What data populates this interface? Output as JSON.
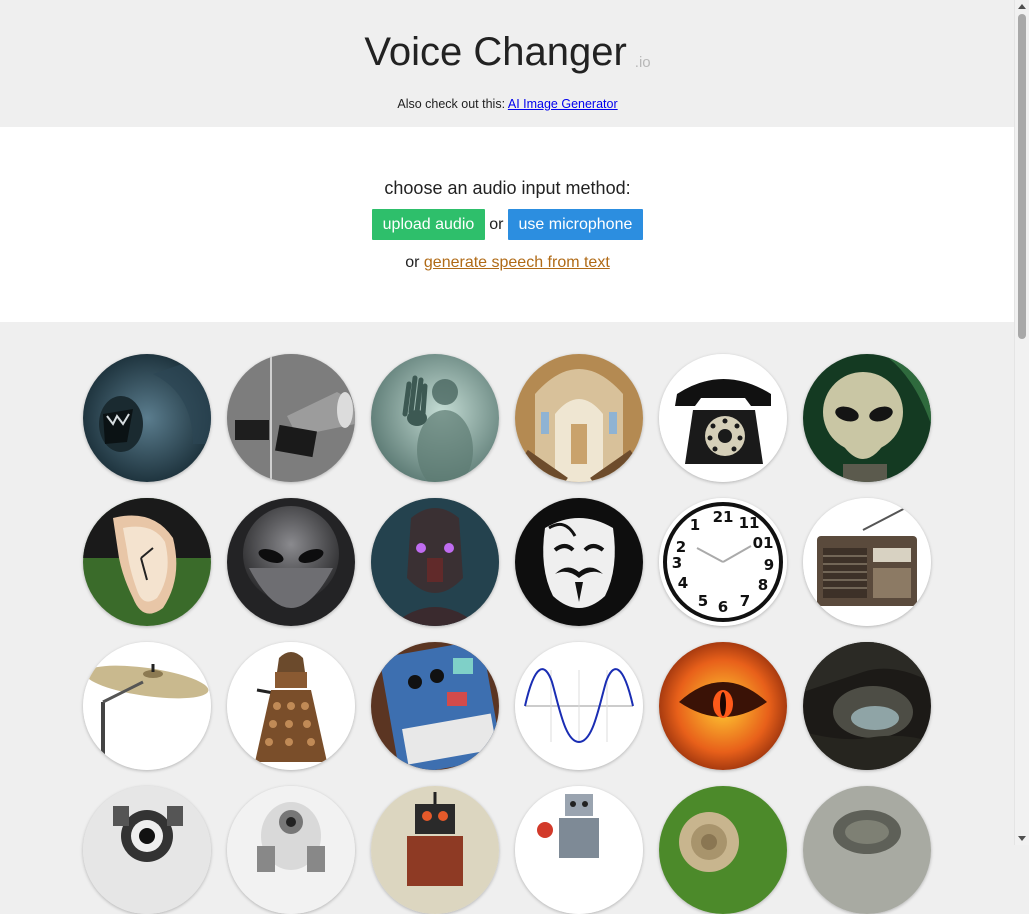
{
  "header": {
    "title": "Voice Changer",
    "title_suffix": ".io",
    "also_prefix": "Also check out this:",
    "also_link": "AI Image Generator"
  },
  "input": {
    "prompt": "choose an audio input method:",
    "upload_label": "upload audio",
    "or_label": "or",
    "mic_label": "use microphone",
    "gen_prefix": "or",
    "gen_link": "generate speech from text"
  },
  "colors": {
    "upload_button": "#2ebf6b",
    "mic_button": "#2c8ee0",
    "gen_link": "#b06a16",
    "page_bg": "#efefef"
  },
  "voices": [
    {
      "icon": "monster-roar-icon"
    },
    {
      "icon": "megaphone-icon"
    },
    {
      "icon": "ghost-icon"
    },
    {
      "icon": "cathedral-icon"
    },
    {
      "icon": "telephone-icon"
    },
    {
      "icon": "alien-icon"
    },
    {
      "icon": "melting-clock-icon"
    },
    {
      "icon": "grey-alien-icon"
    },
    {
      "icon": "robot-mask-icon"
    },
    {
      "icon": "anonymous-mask-icon"
    },
    {
      "icon": "reversed-clock-icon"
    },
    {
      "icon": "radio-icon"
    },
    {
      "icon": "cymbal-icon"
    },
    {
      "icon": "dalek-icon"
    },
    {
      "icon": "guitar-pedal-icon"
    },
    {
      "icon": "sine-wave-icon"
    },
    {
      "icon": "fire-eye-icon"
    },
    {
      "icon": "cave-icon"
    },
    {
      "icon": "robot-eye-icon"
    },
    {
      "icon": "white-robot-icon"
    },
    {
      "icon": "toy-robot-icon"
    },
    {
      "icon": "tin-robot-icon"
    },
    {
      "icon": "snail-icon"
    },
    {
      "icon": "turtle-icon"
    }
  ]
}
